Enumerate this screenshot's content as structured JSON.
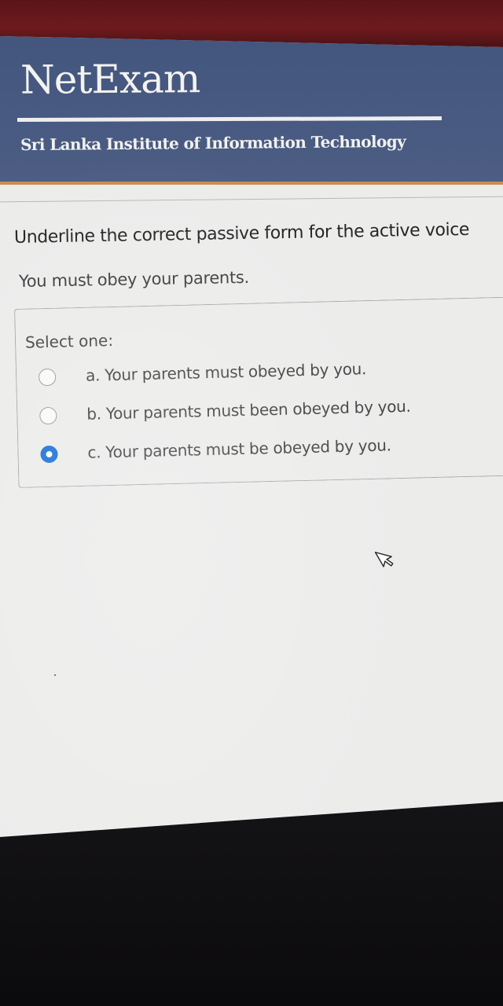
{
  "header": {
    "logo": "NetExam",
    "subtitle": "Sri Lanka Institute of Information Technology"
  },
  "question": {
    "prompt": "Underline the correct passive form for the active voice",
    "sentence": "You must obey your parents.",
    "select_label": "Select one:",
    "options": [
      {
        "label": "a. Your parents must obeyed by you.",
        "checked": false
      },
      {
        "label": "b. Your parents must been obeyed by you.",
        "checked": false
      },
      {
        "label": "c. Your parents must be obeyed by you.",
        "checked": true
      }
    ]
  },
  "colors": {
    "header_bg": "#485a82",
    "header_accent": "#c98d4e",
    "radio_selected": "#1f73d6"
  }
}
